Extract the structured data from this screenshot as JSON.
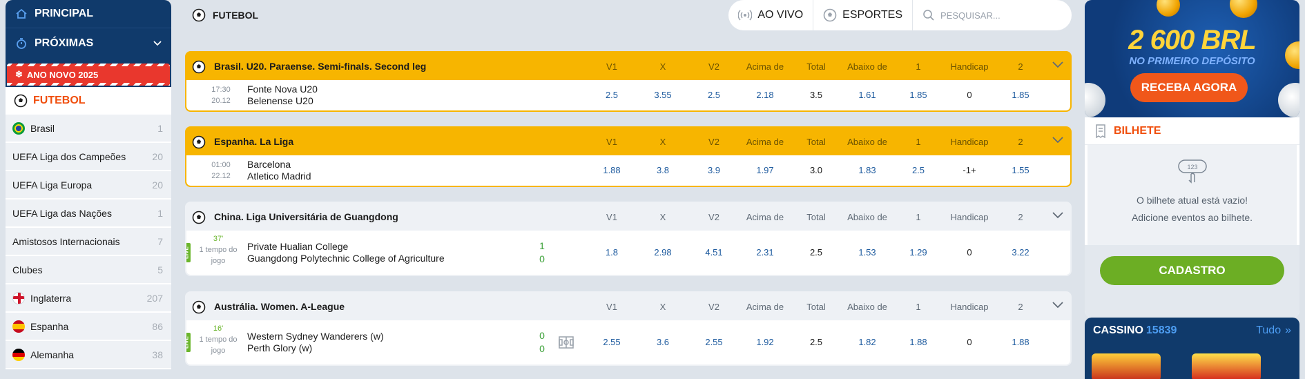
{
  "sidebar": {
    "principal": "PRINCIPAL",
    "proximas": "PRÓXIMAS",
    "promo": "ANO NOVO 2025",
    "sport": "FUTEBOL",
    "items": [
      {
        "label": "Brasil",
        "count": "1",
        "flag": "brazil-flag-icon"
      },
      {
        "label": "UEFA Liga dos Campeões",
        "count": "20"
      },
      {
        "label": "UEFA Liga Europa",
        "count": "20"
      },
      {
        "label": "UEFA Liga das Nações",
        "count": "1"
      },
      {
        "label": "Amistosos Internacionais",
        "count": "7"
      },
      {
        "label": "Clubes",
        "count": "5"
      },
      {
        "label": "Inglaterra",
        "count": "207",
        "flag": "england-flag-icon"
      },
      {
        "label": "Espanha",
        "count": "86",
        "flag": "spain-flag-icon"
      },
      {
        "label": "Alemanha",
        "count": "38",
        "flag": "germany-flag-icon"
      }
    ]
  },
  "topbar": {
    "sport_title": "FUTEBOL",
    "ao_vivo": "AO VIVO",
    "esportes": "ESPORTES",
    "search_placeholder": "PESQUISAR..."
  },
  "columns": [
    "V1",
    "X",
    "V2",
    "Acima de",
    "Total",
    "Abaixo de",
    "1",
    "Handicap",
    "2"
  ],
  "leagues": [
    {
      "name": "Brasil. U20. Paraense. Semi-finals. Second leg",
      "highlight": true,
      "match": {
        "time": "17:30",
        "date": "20.12",
        "home": "Fonte Nova U20",
        "away": "Belenense U20",
        "odds": [
          "2.5",
          "3.55",
          "2.5",
          "2.18",
          "3.5",
          "1.61",
          "1.85",
          "0",
          "1.85"
        ]
      }
    },
    {
      "name": "Espanha. La Liga",
      "highlight": true,
      "match": {
        "time": "01:00",
        "date": "22.12",
        "home": "Barcelona",
        "away": "Atletico Madrid",
        "odds": [
          "1.88",
          "3.8",
          "3.9",
          "1.97",
          "3.0",
          "1.83",
          "2.5",
          "-1+",
          "1.55"
        ]
      }
    },
    {
      "name": "China. Liga Universitária de Guangdong",
      "highlight": false,
      "match": {
        "live": "LIVE",
        "minute": "37'",
        "period": "1 tempo do jogo",
        "home": "Private Hualian College",
        "away": "Guangdong Polytechnic College of Agriculture",
        "score_home": "1",
        "score_away": "0",
        "odds": [
          "1.8",
          "2.98",
          "4.51",
          "2.31",
          "2.5",
          "1.53",
          "1.29",
          "0",
          "3.22"
        ]
      }
    },
    {
      "name": "Austrália. Women. A-League",
      "highlight": false,
      "match": {
        "live": "LIVE",
        "minute": "16'",
        "period": "1 tempo do jogo",
        "home": "Western Sydney Wanderers (w)",
        "away": "Perth Glory (w)",
        "score_home": "0",
        "score_away": "0",
        "odds": [
          "2.55",
          "3.6",
          "2.55",
          "1.92",
          "2.5",
          "1.82",
          "1.88",
          "0",
          "1.88"
        ]
      }
    }
  ],
  "banner": {
    "amount": "2 600 BRL",
    "subtitle": "NO PRIMEIRO DEPÓSITO",
    "button": "RECEBA AGORA"
  },
  "ticket": {
    "title": "BILHETE",
    "empty_line1": "O bilhete atual está vazio!",
    "empty_line2": "Adicione eventos ao bilhete.",
    "button": "CADASTRO"
  },
  "casino": {
    "title": "CASSINO",
    "count": "15839",
    "all": "Tudo"
  },
  "colors": {
    "navy": "#103a6b",
    "accent_orange": "#f04e0c",
    "highlight_yellow": "#f7b500",
    "odd_blue": "#1d5a9e",
    "green": "#6cae24"
  }
}
